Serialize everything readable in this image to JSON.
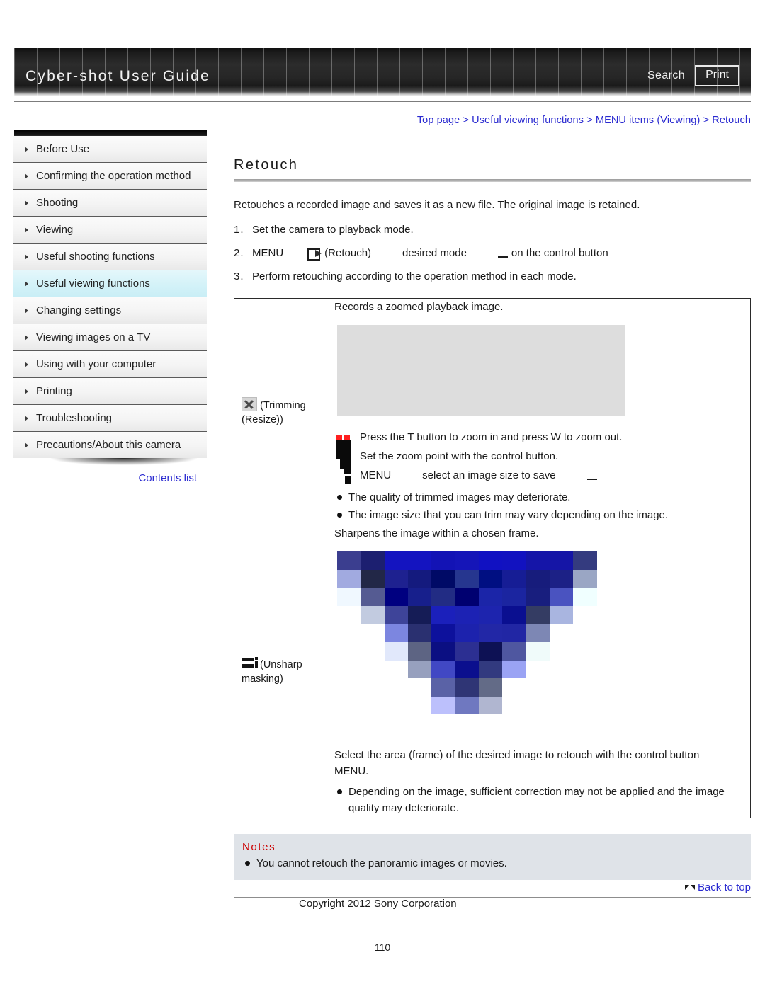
{
  "header": {
    "title": "Cyber-shot User Guide",
    "search_label": "Search",
    "print_label": "Print"
  },
  "breadcrumb": {
    "text": "Top page > Useful viewing functions > MENU items (Viewing) > Retouch"
  },
  "sidebar": {
    "items": [
      {
        "label": "Before Use",
        "active": false
      },
      {
        "label": "Confirming the operation method",
        "active": false
      },
      {
        "label": "Shooting",
        "active": false
      },
      {
        "label": "Viewing",
        "active": false
      },
      {
        "label": "Useful shooting functions",
        "active": false
      },
      {
        "label": "Useful viewing functions",
        "active": true
      },
      {
        "label": "Changing settings",
        "active": false
      },
      {
        "label": "Viewing images on a TV",
        "active": false
      },
      {
        "label": "Using with your computer",
        "active": false
      },
      {
        "label": "Printing",
        "active": false
      },
      {
        "label": "Troubleshooting",
        "active": false
      },
      {
        "label": "Precautions/About this camera",
        "active": false
      }
    ],
    "contents_list_label": "Contents list"
  },
  "main": {
    "title": "Retouch",
    "intro": "Retouches a recorded image and saves it as a new file. The original image is retained.",
    "steps": [
      {
        "num": "1.",
        "parts": [
          "Set the camera to playback mode."
        ]
      },
      {
        "num": "2.",
        "menu": "MENU",
        "icon_label": "(Retouch)",
        "desired_mode": "desired mode",
        "tail": "on the control button"
      },
      {
        "num": "3.",
        "parts": [
          "Perform retouching according to the operation method in each mode."
        ]
      }
    ],
    "table": {
      "rows": [
        {
          "mode_name": "(Trimming (Resize))",
          "icon": "broken-image-icon",
          "lead": "Records a zoomed playback image.",
          "procedure": [
            "Press the T button to zoom in and press W to zoom out.",
            "Set the zoom point with the control button.",
            "MENU"
          ],
          "proc3_tail": "select an image size to save",
          "bullets": [
            "The quality of trimmed images may deteriorate.",
            "The image size that you can trim may vary depending on the image."
          ]
        },
        {
          "mode_name": "(Unsharp masking)",
          "icon": "unsharp-mask-icon",
          "lead": "Sharpens the image within a chosen frame.",
          "procedure": [
            "Select the area (frame) of the desired image to retouch with the control button",
            "MENU."
          ],
          "bullets": [
            "Depending on the image, sufficient correction may not be applied and the image quality may deteriorate."
          ]
        }
      ]
    }
  },
  "notes": {
    "title": "Notes",
    "items": [
      "You cannot retouch the panoramic images or movies."
    ]
  },
  "footer": {
    "back_to_top_label": "Back to top",
    "copyright": "Copyright 2012 Sony Corporation",
    "page_number": "110"
  },
  "mosaic": {
    "rows": [
      [
        "#3b3e8f",
        "#1c1f70",
        "#1414c0",
        "#1414c0",
        "#1313b5",
        "#1515b8",
        "#1111c2",
        "#1212c0",
        "#1515a8",
        "#1515a6",
        "#343b7f",
        ""
      ],
      [
        "#a1aae0",
        "#222747",
        "#1e2190",
        "#141a7e",
        "#000a66",
        "#26368f",
        "#000f82",
        "#161d95",
        "#171c7c",
        "#1c2186",
        "#9aa6c4",
        ""
      ],
      [
        "#f0f8ff",
        "#555b92",
        "#000080",
        "#171f8c",
        "#222c84",
        "#000070",
        "#1b25a8",
        "#1b25a0",
        "#181e7e",
        "#4a53c0",
        "#f0ffff",
        ""
      ],
      [
        "",
        "#c2cbe0",
        "#3e4499",
        "#151c56",
        "#1b20bb",
        "#1c22b4",
        "#1d24ae",
        "#0a0f90",
        "#343c63",
        "#a9b5e0",
        "",
        ""
      ],
      [
        "",
        "",
        "#7c86e0",
        "#2a3070",
        "#0d119c",
        "#1c22ad",
        "#2227a6",
        "#2126a4",
        "#7d87b4",
        "",
        "",
        ""
      ],
      [
        "",
        "",
        "#e1e8fb",
        "#5d6483",
        "#0b0f82",
        "#2c2f92",
        "#0d1154",
        "#4f57a0",
        "#f0fbfa",
        "",
        "",
        ""
      ],
      [
        "",
        "",
        "",
        "#97a0be",
        "#4148c4",
        "#0b0f8e",
        "#323a7f",
        "#9aa3f4",
        "",
        "",
        "",
        ""
      ],
      [
        "",
        "",
        "",
        "",
        "#5a62a6",
        "#2f3575",
        "#636b87",
        "",
        "",
        "",
        "",
        ""
      ],
      [
        "",
        "",
        "",
        "",
        "#bcc0fc",
        "#6f78c0",
        "#b0b6d0",
        "",
        "",
        "",
        "",
        ""
      ],
      [
        "",
        "",
        "",
        "",
        "",
        "",
        "",
        "",
        "",
        "",
        "",
        ""
      ]
    ]
  }
}
